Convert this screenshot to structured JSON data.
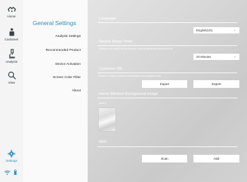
{
  "nav": {
    "home": "Home",
    "customer": "Customer",
    "analysis": "Analysis",
    "view": "View",
    "settings": "Settings"
  },
  "menu": {
    "title": "General Settings",
    "items": [
      "Analysis Settings",
      "Recommended Product",
      "Device Activation",
      "Screen Color Filter",
      "About"
    ]
  },
  "language": {
    "title": "Language",
    "value": "English(US)"
  },
  "sleep": {
    "title": "Device Sleep Timer",
    "hint": "If there is no action on the device, it will be automatically turned off.",
    "value": "20 Minutes"
  },
  "customer_db": {
    "title": "Customer DB",
    "hint": "Export or import customer information and analysis data.",
    "import": "Import",
    "export": "Export"
  },
  "background": {
    "title": "Home Window Background Image",
    "hint": "Mark it"
  },
  "wifi": {
    "title": "WiFi",
    "scan": "Scan",
    "add": "Add"
  },
  "colors": {
    "accent": "#2f8fbd",
    "sidebar_text": "#3d4548"
  }
}
